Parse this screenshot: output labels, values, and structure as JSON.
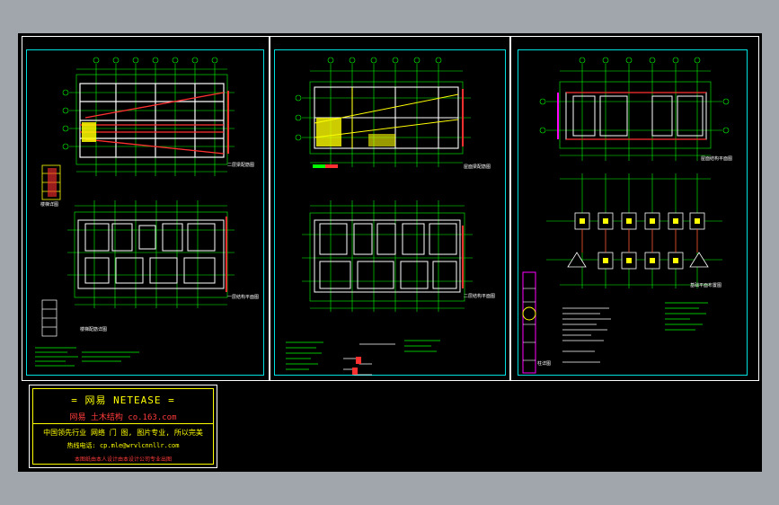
{
  "window": {
    "background": "#a1a5ac",
    "canvas": "#000000"
  },
  "colors": {
    "frame": "#ffffff",
    "border": "#00e0e0",
    "grid": "#00ff00",
    "struct": "#ffffff",
    "red": "#ff3030",
    "yellow": "#ffff00",
    "magenta": "#ff00ff"
  },
  "sheets": [
    {
      "id": "sheet-1",
      "plan_labels": [
        "二层梁配筋图",
        "一层结构平面图"
      ],
      "detail_labels": [
        "楼梯详图",
        "楼梯配筋详图"
      ]
    },
    {
      "id": "sheet-2",
      "plan_labels": [
        "屋面梁配筋图",
        "二层结构平面图"
      ]
    },
    {
      "id": "sheet-3",
      "plan_labels": [
        "屋面结构平面图",
        "基础平面布置图"
      ],
      "detail_labels": [
        "柱详图"
      ]
    }
  ],
  "stamp": {
    "title": "= 网易  NETEASE =",
    "subtitle": "网易 土木结构   co.163.com",
    "slogan": "中国领先行业 网络 门 图, 图片专业, 所以完美",
    "contact": "热线电话:  cp.mle@wrvlcnnllr.com",
    "footer": "本图纸由本人设计由本设计公司专业出图"
  }
}
